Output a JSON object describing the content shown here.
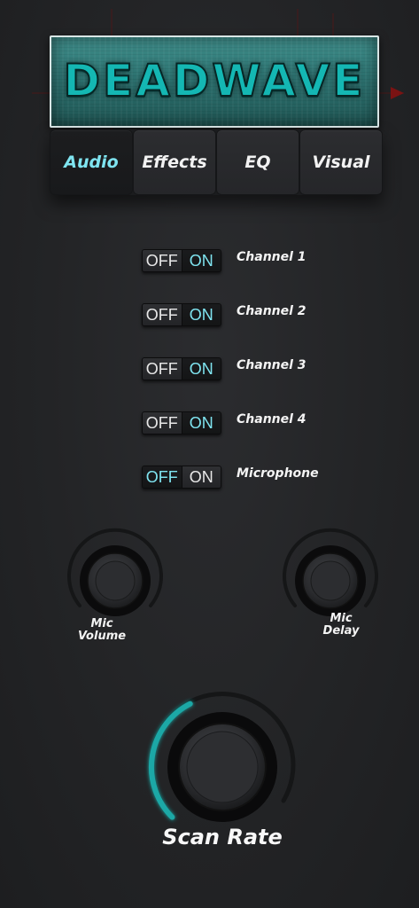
{
  "logo": {
    "text": "DEADWAVE"
  },
  "tabs": [
    {
      "label": "Audio",
      "active": true
    },
    {
      "label": "Effects",
      "active": false
    },
    {
      "label": "EQ",
      "active": false
    },
    {
      "label": "Visual",
      "active": false
    }
  ],
  "toggles": {
    "off_label": "OFF",
    "on_label": "ON"
  },
  "channels": [
    {
      "label": "Channel 1",
      "state": "on"
    },
    {
      "label": "Channel 2",
      "state": "on"
    },
    {
      "label": "Channel 3",
      "state": "on"
    },
    {
      "label": "Channel 4",
      "state": "on"
    },
    {
      "label": "Microphone",
      "state": "off"
    }
  ],
  "knobs": {
    "mic_volume": {
      "label_line1": "Mic",
      "label_line2": "Volume",
      "level": 0.0
    },
    "mic_delay": {
      "label_line1": "Mic",
      "label_line2": "Delay",
      "level": 0.0
    },
    "scan_rate": {
      "label": "Scan Rate",
      "level": 0.4
    }
  },
  "colors": {
    "accent": "#1aa8a6",
    "active_text": "#7fe4f0",
    "background": "#222325"
  }
}
